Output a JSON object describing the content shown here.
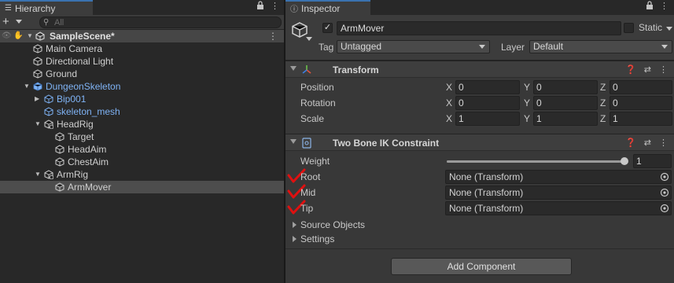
{
  "hierarchy": {
    "tab_label": "Hierarchy",
    "search_placeholder": "All",
    "scene": {
      "name": "SampleScene*"
    },
    "items": [
      {
        "label": "Main Camera",
        "depth": 1,
        "arrow": "",
        "prefab": false
      },
      {
        "label": "Directional Light",
        "depth": 1,
        "arrow": "",
        "prefab": false
      },
      {
        "label": "Ground",
        "depth": 1,
        "arrow": "",
        "prefab": false
      },
      {
        "label": "DungeonSkeleton",
        "depth": 1,
        "arrow": "down",
        "prefab": true
      },
      {
        "label": "Bip001",
        "depth": 2,
        "arrow": "right",
        "prefab": true
      },
      {
        "label": "skeleton_mesh",
        "depth": 2,
        "arrow": "",
        "prefab": true
      },
      {
        "label": "HeadRig",
        "depth": 2,
        "arrow": "down",
        "prefab": false,
        "rig": true
      },
      {
        "label": "Target",
        "depth": 3,
        "arrow": "",
        "prefab": false
      },
      {
        "label": "HeadAim",
        "depth": 3,
        "arrow": "",
        "prefab": false
      },
      {
        "label": "ChestAim",
        "depth": 3,
        "arrow": "",
        "prefab": false
      },
      {
        "label": "ArmRig",
        "depth": 2,
        "arrow": "down",
        "prefab": false,
        "rig": true
      },
      {
        "label": "ArmMover",
        "depth": 3,
        "arrow": "",
        "prefab": false,
        "selected": true
      }
    ]
  },
  "inspector": {
    "tab_label": "Inspector",
    "object": {
      "name": "ArmMover",
      "active": true,
      "static_label": "Static",
      "tag_label": "Tag",
      "tag_value": "Untagged",
      "layer_label": "Layer",
      "layer_value": "Default"
    },
    "transform": {
      "title": "Transform",
      "rows": [
        {
          "label": "Position",
          "x": "0",
          "y": "0",
          "z": "0"
        },
        {
          "label": "Rotation",
          "x": "0",
          "y": "0",
          "z": "0"
        },
        {
          "label": "Scale",
          "x": "1",
          "y": "1",
          "z": "1"
        }
      ],
      "axis_x": "X",
      "axis_y": "Y",
      "axis_z": "Z"
    },
    "two_bone": {
      "title": "Two Bone IK Constraint",
      "weight_label": "Weight",
      "weight_value": "1",
      "weight_fraction": 1.0,
      "root_label": "Root",
      "mid_label": "Mid",
      "tip_label": "Tip",
      "none_value": "None (Transform)",
      "source_objects": "Source Objects",
      "settings": "Settings"
    },
    "add_component": "Add Component"
  },
  "colors": {
    "accent_tab": "#3a72b0",
    "prefab_text": "#7fb3f5",
    "annotation_check": "#e01010"
  }
}
